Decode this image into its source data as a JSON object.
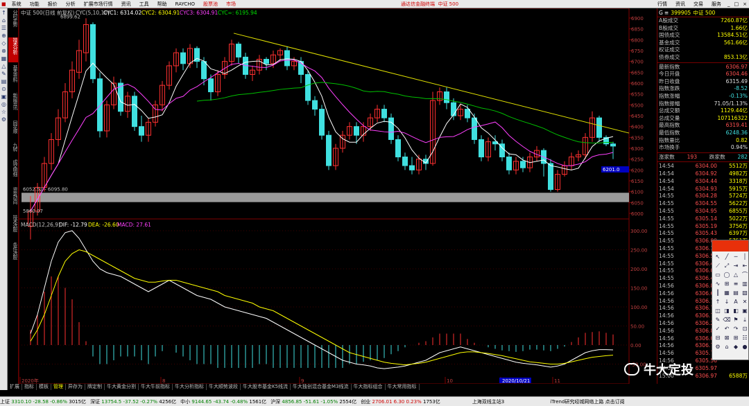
{
  "menu": {
    "items": [
      "系统",
      "功能",
      "报价",
      "分析",
      "扩展市场行情",
      "资讯",
      "工具",
      "帮助",
      "RAYCHO",
      "股票池",
      "市场"
    ],
    "app_title": "通达信金融终端",
    "index_label": "中证 500",
    "right_items": [
      "行情",
      "资讯",
      "交易",
      "服务"
    ]
  },
  "nav_tabs": [
    {
      "label": "分时走势",
      "active": false
    },
    {
      "label": "技术分析",
      "active": true
    },
    {
      "label": "基本资料",
      "active": false
    },
    {
      "label": "新闻资讯",
      "active": false
    },
    {
      "label": "同花顺",
      "active": false
    },
    {
      "label": "九转",
      "active": false
    },
    {
      "label": "成交明细",
      "active": false
    },
    {
      "label": "资金动向",
      "active": false
    },
    {
      "label": "技术选股",
      "active": false
    },
    {
      "label": "条件选股",
      "active": false
    }
  ],
  "chart_header": {
    "title": "中证 500(日线 前复权)",
    "cyc": "CYC(5,10,10)",
    "cyc1": "CYC1: 6314.02",
    "cyc2": "CYC2: 6304.91",
    "cyc3": "CYC3: 6304.91",
    "cyc_inf": "CYC∞: 6195.94",
    "high_label": "6899.62",
    "range_label": "6052.52 - 6095.80",
    "low_label": "5860.07",
    "price_tag": "6201.0"
  },
  "macd_header": {
    "name": "MACD(12,26,9)",
    "dif": "DIF: -12.79",
    "dea": "DEA: -26.60",
    "macd": "MACD: 27.61"
  },
  "price_axis": [
    "6900",
    "6850",
    "6800",
    "6750",
    "6700",
    "6650",
    "6600",
    "6550",
    "6500",
    "6450",
    "6400",
    "6350",
    "6300",
    "6250",
    "6200",
    "6150",
    "6100",
    "6050",
    "6000"
  ],
  "macd_axis": [
    "300.00",
    "250.00",
    "200.00",
    "150.00",
    "100.00",
    "50.00",
    "0.00",
    "-50.00"
  ],
  "time_axis": [
    "2020年",
    "8",
    "9",
    "10",
    "2020/10/21",
    "11"
  ],
  "panel": {
    "code": "399905",
    "name": "中证 500",
    "group1": [
      {
        "k": "A股成交",
        "v": "7260.87亿",
        "c": "y"
      },
      {
        "k": "B股成交",
        "v": "1.66亿",
        "c": "y"
      },
      {
        "k": "国债成交",
        "v": "13584.51亿",
        "c": "y"
      },
      {
        "k": "基金成交",
        "v": "561.66亿",
        "c": "y"
      },
      {
        "k": "权证成交",
        "v": "",
        "c": "y"
      },
      {
        "k": "债券成交",
        "v": "853.13亿",
        "c": "y"
      }
    ],
    "group2": [
      {
        "k": "最新指数",
        "v": "6306.97",
        "c": "r"
      },
      {
        "k": "今日开盘",
        "v": "6304.46",
        "c": "r"
      },
      {
        "k": "昨日收盘",
        "v": "6315.49",
        "c": "w"
      },
      {
        "k": "指数涨跌",
        "v": "-8.52",
        "c": "g"
      },
      {
        "k": "指数涨幅",
        "v": "-0.13%",
        "c": "g"
      },
      {
        "k": "指数振幅",
        "v": "71.05/1.13%",
        "c": "w"
      },
      {
        "k": "总成交额",
        "v": "1129.44亿",
        "c": "y"
      },
      {
        "k": "总成交量",
        "v": "107116322",
        "c": "y"
      },
      {
        "k": "最高指数",
        "v": "6319.41",
        "c": "r"
      },
      {
        "k": "最低指数",
        "v": "6248.36",
        "c": "g"
      },
      {
        "k": "指数量比",
        "v": "0.82",
        "c": "y"
      },
      {
        "k": "市场换手",
        "v": "0.94%",
        "c": "w"
      }
    ],
    "updown": {
      "up_label": "涨家数",
      "up": "193",
      "down_label": "跌家数",
      "down": "282"
    },
    "ticks": [
      {
        "t": "14:54",
        "p": "6304.00",
        "v": "5512万"
      },
      {
        "t": "14:54",
        "p": "6304.92",
        "v": "4982万"
      },
      {
        "t": "14:54",
        "p": "6304.44",
        "v": "3318万"
      },
      {
        "t": "14:54",
        "p": "6304.93",
        "v": "5915万"
      },
      {
        "t": "14:55",
        "p": "6304.28",
        "v": "5724万"
      },
      {
        "t": "14:55",
        "p": "6304.55",
        "v": "5622万"
      },
      {
        "t": "14:55",
        "p": "6304.95",
        "v": "6855万"
      },
      {
        "t": "14:55",
        "p": "6305.14",
        "v": "5022万"
      },
      {
        "t": "14:55",
        "p": "6305.19",
        "v": "3756万"
      },
      {
        "t": "14:55",
        "p": "6305.43",
        "v": "6397万"
      },
      {
        "t": "14:55",
        "p": "6306.00",
        "v": "5751万"
      },
      {
        "t": "14:55",
        "p": "6306.10",
        "v": ""
      },
      {
        "t": "14:55",
        "p": "6306.57",
        "v": ""
      },
      {
        "t": "14:55",
        "p": "6306.44",
        "v": ""
      },
      {
        "t": "14:55",
        "p": "6306.05",
        "v": ""
      },
      {
        "t": "14:55",
        "p": "6306.46",
        "v": ""
      },
      {
        "t": "14:56",
        "p": "6306.84",
        "v": ""
      },
      {
        "t": "14:56",
        "p": "6306.63",
        "v": ""
      },
      {
        "t": "14:56",
        "p": "6306.77",
        "v": ""
      },
      {
        "t": "14:56",
        "p": "6306.72",
        "v": ""
      },
      {
        "t": "14:56",
        "p": "6306.77",
        "v": ""
      },
      {
        "t": "14:56",
        "p": "6306.27",
        "v": ""
      },
      {
        "t": "14:56",
        "p": "6306.83",
        "v": ""
      },
      {
        "t": "14:56",
        "p": "6306.03",
        "v": ""
      },
      {
        "t": "14:56",
        "p": "6306.75",
        "v": ""
      },
      {
        "t": "14:56",
        "p": "6305.75",
        "v": ""
      },
      {
        "t": "14:56",
        "p": "6305.56",
        "v": ""
      },
      {
        "t": "14:56",
        "p": "6305.97",
        "v": ""
      },
      {
        "t": "15:00",
        "p": "6306.97",
        "v": "6588万"
      }
    ]
  },
  "bottom_tabs": [
    {
      "label": "指标",
      "active": false
    },
    {
      "label": "模板",
      "active": false
    },
    {
      "label": "管理",
      "active": true
    },
    {
      "label": "异存为",
      "active": false
    },
    {
      "label": "牌定制",
      "active": false
    },
    {
      "label": "牛大黄金分割",
      "active": false
    },
    {
      "label": "牛大牛前指标",
      "active": false
    },
    {
      "label": "牛大分析指标",
      "active": false
    },
    {
      "label": "牛大顺势波段",
      "active": false
    },
    {
      "label": "牛大股市基金K5线流",
      "active": false
    },
    {
      "label": "牛大独创混合基金M3线流",
      "active": false
    },
    {
      "label": "牛大指标组合",
      "active": false
    },
    {
      "label": "牛大常用指标",
      "active": false
    }
  ],
  "statusbar": [
    {
      "label": "上证",
      "v": "3310.10",
      "chg": "-28.58",
      "pct": "-0.86%",
      "amt": "3015亿",
      "dir": "dn"
    },
    {
      "label": "深证",
      "v": "13754.5",
      "chg": "-37.52",
      "pct": "-0.27%",
      "amt": "4256亿",
      "dir": "dn"
    },
    {
      "label": "中小",
      "v": "9144.65",
      "chg": "-43.74",
      "pct": "-0.48%",
      "amt": "1561亿",
      "dir": "dn"
    },
    {
      "label": "沪深",
      "v": "4856.85",
      "chg": "-51.61",
      "pct": "-1.05%",
      "amt": "2554亿",
      "dir": "dn"
    },
    {
      "label": "创业",
      "v": "2706.01",
      "chg": "6.30",
      "pct": "0.23%",
      "amt": "1753亿",
      "dir": "up"
    }
  ],
  "status_right": "上海双线主站3",
  "status_far_right": "iTrend研究经城网络上路 点击订阅",
  "watermark": "牛大定投",
  "colors": {
    "up": "#ff3030",
    "down": "#40e0e0",
    "ma1": "#ffffff",
    "ma2": "#ff40ff",
    "ma3": "#00c000",
    "trend": "#e0e000",
    "accent": "#c00000"
  },
  "chart_data": {
    "type": "candlestick",
    "ylim": [
      6000,
      6900
    ],
    "candles": [
      [
        5940,
        6010,
        5880,
        6080
      ],
      [
        6010,
        6120,
        5990,
        6140
      ],
      [
        6120,
        6230,
        6100,
        6260
      ],
      [
        6230,
        6340,
        6200,
        6370
      ],
      [
        6340,
        6440,
        6310,
        6480
      ],
      [
        6440,
        6560,
        6420,
        6600
      ],
      [
        6560,
        6660,
        6530,
        6700
      ],
      [
        6650,
        6750,
        6620,
        6800
      ],
      [
        6740,
        6870,
        6700,
        6899
      ],
      [
        6870,
        6620,
        6600,
        6880
      ],
      [
        6620,
        6380,
        6350,
        6650
      ],
      [
        6380,
        6500,
        6350,
        6520
      ],
      [
        6500,
        6600,
        6480,
        6630
      ],
      [
        6600,
        6470,
        6450,
        6620
      ],
      [
        6470,
        6540,
        6440,
        6560
      ],
      [
        6540,
        6400,
        6380,
        6560
      ],
      [
        6400,
        6360,
        6330,
        6450
      ],
      [
        6360,
        6420,
        6330,
        6440
      ],
      [
        6420,
        6500,
        6400,
        6520
      ],
      [
        6500,
        6590,
        6470,
        6610
      ],
      [
        6590,
        6680,
        6570,
        6700
      ],
      [
        6680,
        6740,
        6650,
        6760
      ],
      [
        6740,
        6690,
        6660,
        6760
      ],
      [
        6690,
        6760,
        6670,
        6780
      ],
      [
        6760,
        6700,
        6670,
        6770
      ],
      [
        6700,
        6620,
        6590,
        6720
      ],
      [
        6620,
        6560,
        6520,
        6640
      ],
      [
        6560,
        6640,
        6540,
        6660
      ],
      [
        6640,
        6700,
        6620,
        6720
      ],
      [
        6700,
        6780,
        6680,
        6800
      ],
      [
        6780,
        6720,
        6690,
        6790
      ],
      [
        6720,
        6640,
        6620,
        6740
      ],
      [
        6640,
        6660,
        6610,
        6680
      ],
      [
        6660,
        6710,
        6640,
        6730
      ],
      [
        6710,
        6690,
        6660,
        6720
      ],
      [
        6690,
        6730,
        6670,
        6750
      ],
      [
        6730,
        6750,
        6700,
        6760
      ],
      [
        6750,
        6680,
        6660,
        6770
      ],
      [
        6680,
        6700,
        6660,
        6720
      ],
      [
        6700,
        6640,
        6600,
        6720
      ],
      [
        6640,
        6520,
        6500,
        6660
      ],
      [
        6520,
        6480,
        6450,
        6540
      ],
      [
        6480,
        6360,
        6340,
        6500
      ],
      [
        6360,
        6220,
        6200,
        6380
      ],
      [
        6220,
        6300,
        6200,
        6320
      ],
      [
        6300,
        6360,
        6280,
        6380
      ],
      [
        6360,
        6400,
        6340,
        6420
      ],
      [
        6400,
        6360,
        6320,
        6420
      ],
      [
        6360,
        6400,
        6330,
        6420
      ],
      [
        6400,
        6440,
        6380,
        6460
      ],
      [
        6440,
        6480,
        6420,
        6500
      ],
      [
        6480,
        6440,
        6420,
        6500
      ],
      [
        6440,
        6340,
        6320,
        6460
      ],
      [
        6340,
        6260,
        6240,
        6360
      ],
      [
        6260,
        6220,
        6200,
        6280
      ],
      [
        6220,
        6200,
        6180,
        6260
      ],
      [
        6200,
        6250,
        6180,
        6270
      ],
      [
        6250,
        6230,
        6200,
        6270
      ],
      [
        6230,
        6520,
        6220,
        6560
      ],
      [
        6520,
        6560,
        6500,
        6580
      ],
      [
        6560,
        6510,
        6480,
        6580
      ],
      [
        6510,
        6450,
        6430,
        6530
      ],
      [
        6450,
        6480,
        6430,
        6500
      ],
      [
        6480,
        6440,
        6420,
        6500
      ],
      [
        6440,
        6340,
        6320,
        6460
      ],
      [
        6340,
        6260,
        6240,
        6360
      ],
      [
        6260,
        6330,
        6240,
        6350
      ],
      [
        6330,
        6320,
        6290,
        6360
      ],
      [
        6320,
        6260,
        6240,
        6340
      ],
      [
        6260,
        6200,
        6180,
        6280
      ],
      [
        6200,
        6240,
        6180,
        6260
      ],
      [
        6240,
        6210,
        6190,
        6260
      ],
      [
        6210,
        6260,
        6190,
        6280
      ],
      [
        6260,
        6290,
        6240,
        6310
      ],
      [
        6290,
        6230,
        6170,
        6300
      ],
      [
        6230,
        6110,
        6100,
        6250
      ],
      [
        6110,
        6180,
        6100,
        6200
      ],
      [
        6180,
        6220,
        6170,
        6240
      ],
      [
        6220,
        6260,
        6200,
        6280
      ],
      [
        6260,
        6270,
        6240,
        6290
      ],
      [
        6270,
        6350,
        6250,
        6370
      ],
      [
        6350,
        6440,
        6330,
        6470
      ],
      [
        6440,
        6350,
        6330,
        6450
      ],
      [
        6350,
        6320,
        6310,
        6360
      ],
      [
        6320,
        6310,
        6250,
        6330
      ]
    ],
    "macd_dif": [
      30,
      80,
      150,
      220,
      270,
      295,
      300,
      280,
      250,
      220,
      200,
      190,
      185,
      180,
      170,
      160,
      150,
      140,
      150,
      160,
      170,
      160,
      150,
      140,
      130,
      125,
      120,
      110,
      100,
      95,
      90,
      85,
      80,
      75,
      70,
      60,
      50,
      40,
      30,
      20,
      10,
      0,
      -10,
      -20,
      -30,
      -40,
      -45,
      -50,
      -52,
      -55,
      -60,
      -62,
      -60,
      -58,
      -55,
      -50,
      -45,
      -40,
      -30,
      -20,
      -15,
      -10,
      -5,
      -10,
      -15,
      -20,
      -25,
      -30,
      -35,
      -40,
      -45,
      -48,
      -50,
      -52,
      -55,
      -58,
      -55,
      -50,
      -40,
      -30,
      -20,
      -15,
      -12,
      -12,
      -12.79
    ],
    "macd_dea": [
      10,
      40,
      80,
      130,
      180,
      220,
      240,
      250,
      245,
      235,
      225,
      215,
      205,
      195,
      185,
      175,
      170,
      165,
      165,
      168,
      170,
      170,
      165,
      160,
      155,
      150,
      145,
      140,
      130,
      125,
      120,
      115,
      110,
      100,
      95,
      90,
      80,
      70,
      60,
      50,
      40,
      30,
      20,
      10,
      0,
      -10,
      -20,
      -25,
      -30,
      -35,
      -40,
      -45,
      -48,
      -50,
      -52,
      -50,
      -48,
      -45,
      -40,
      -35,
      -30,
      -25,
      -20,
      -18,
      -18,
      -20,
      -22,
      -25,
      -28,
      -32,
      -36,
      -40,
      -44,
      -46,
      -48,
      -50,
      -50,
      -48,
      -44,
      -40,
      -36,
      -32,
      -30,
      -28,
      -26.6
    ]
  }
}
